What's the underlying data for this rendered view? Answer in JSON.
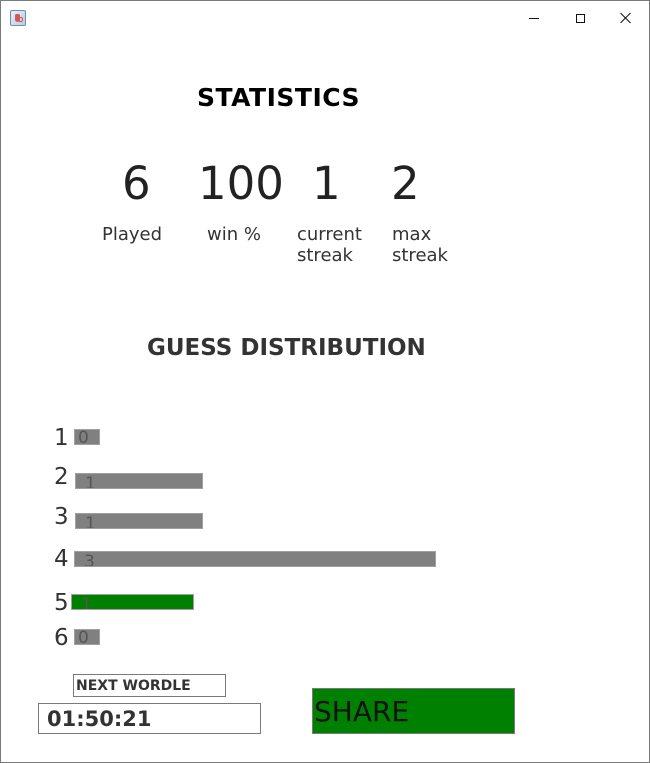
{
  "window": {
    "icon": "java-cup-icon",
    "controls": [
      "minimize-icon",
      "maximize-icon",
      "close-icon"
    ]
  },
  "statistics": {
    "title": "STATISTICS",
    "played": {
      "value": "6",
      "label": "Played"
    },
    "win_pct": {
      "value": "100",
      "label": "win %"
    },
    "current_streak": {
      "value": "1",
      "label_line1": "current",
      "label_line2": "streak"
    },
    "max_streak": {
      "value": "2",
      "label_line1": "max",
      "label_line2": "streak"
    }
  },
  "distribution": {
    "title": "GUESS DISTRIBUTION",
    "rows": [
      {
        "guess": "1",
        "count": "0",
        "color": "#808080"
      },
      {
        "guess": "2",
        "count": "1",
        "color": "#808080"
      },
      {
        "guess": "3",
        "count": "1",
        "color": "#808080"
      },
      {
        "guess": "4",
        "count": "3",
        "color": "#808080"
      },
      {
        "guess": "5",
        "count": "1",
        "color": "#008000"
      },
      {
        "guess": "6",
        "count": "0",
        "color": "#808080"
      }
    ]
  },
  "next": {
    "label": "NEXT WORDLE",
    "timer": "01:50:21"
  },
  "share": {
    "label": "SHARE",
    "color": "#008000"
  }
}
